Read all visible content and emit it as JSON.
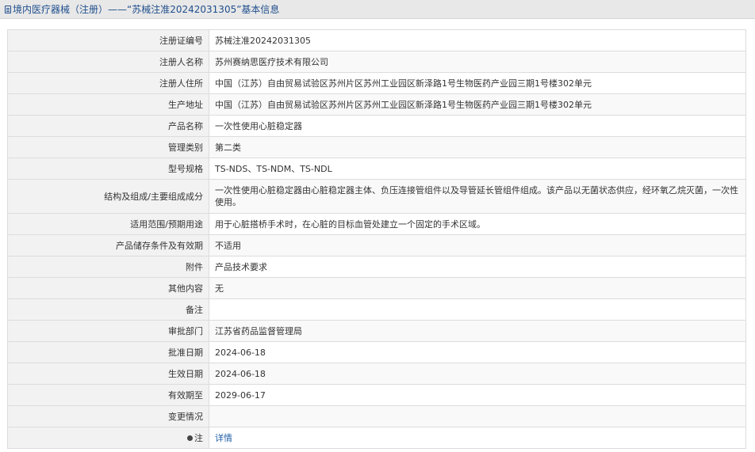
{
  "header": {
    "section": "境内医疗器械（注册）",
    "separator": "——",
    "subject": "“苏械注准20242031305”基本信息"
  },
  "rows": [
    {
      "label": "注册证编号",
      "value": "苏械注准20242031305"
    },
    {
      "label": "注册人名称",
      "value": "苏州赛纳思医疗技术有限公司"
    },
    {
      "label": "注册人住所",
      "value": "中国（江苏）自由贸易试验区苏州片区苏州工业园区新泽路1号生物医药产业园三期1号楼302单元"
    },
    {
      "label": "生产地址",
      "value": "中国（江苏）自由贸易试验区苏州片区苏州工业园区新泽路1号生物医药产业园三期1号楼302单元"
    },
    {
      "label": "产品名称",
      "value": "一次性使用心脏稳定器"
    },
    {
      "label": "管理类别",
      "value": "第二类"
    },
    {
      "label": "型号规格",
      "value": "TS-NDS、TS-NDM、TS-NDL"
    },
    {
      "label": "结构及组成/主要组成成分",
      "value": "一次性使用心脏稳定器由心脏稳定器主体、负压连接管组件以及导管延长管组件组成。该产品以无菌状态供应，经环氧乙烷灭菌，一次性使用。"
    },
    {
      "label": "适用范围/预期用途",
      "value": "用于心脏搭桥手术时，在心脏的目标血管处建立一个固定的手术区域。"
    },
    {
      "label": "产品储存条件及有效期",
      "value": "不适用"
    },
    {
      "label": "附件",
      "value": "产品技术要求"
    },
    {
      "label": "其他内容",
      "value": "无"
    },
    {
      "label": "备注",
      "value": ""
    },
    {
      "label": "审批部门",
      "value": "江苏省药品监督管理局"
    },
    {
      "label": "批准日期",
      "value": "2024-06-18"
    },
    {
      "label": "生效日期",
      "value": "2024-06-18"
    },
    {
      "label": "有效期至",
      "value": "2029-06-17"
    },
    {
      "label": "变更情况",
      "value": ""
    }
  ],
  "note": {
    "label": "注",
    "link_text": "详情",
    "icon": "bulb-icon"
  },
  "colors": {
    "title_text": "#1f4e8c",
    "link": "#1f5fa8",
    "label_bg": "#f2f2f2",
    "border": "#dcdcdc"
  }
}
